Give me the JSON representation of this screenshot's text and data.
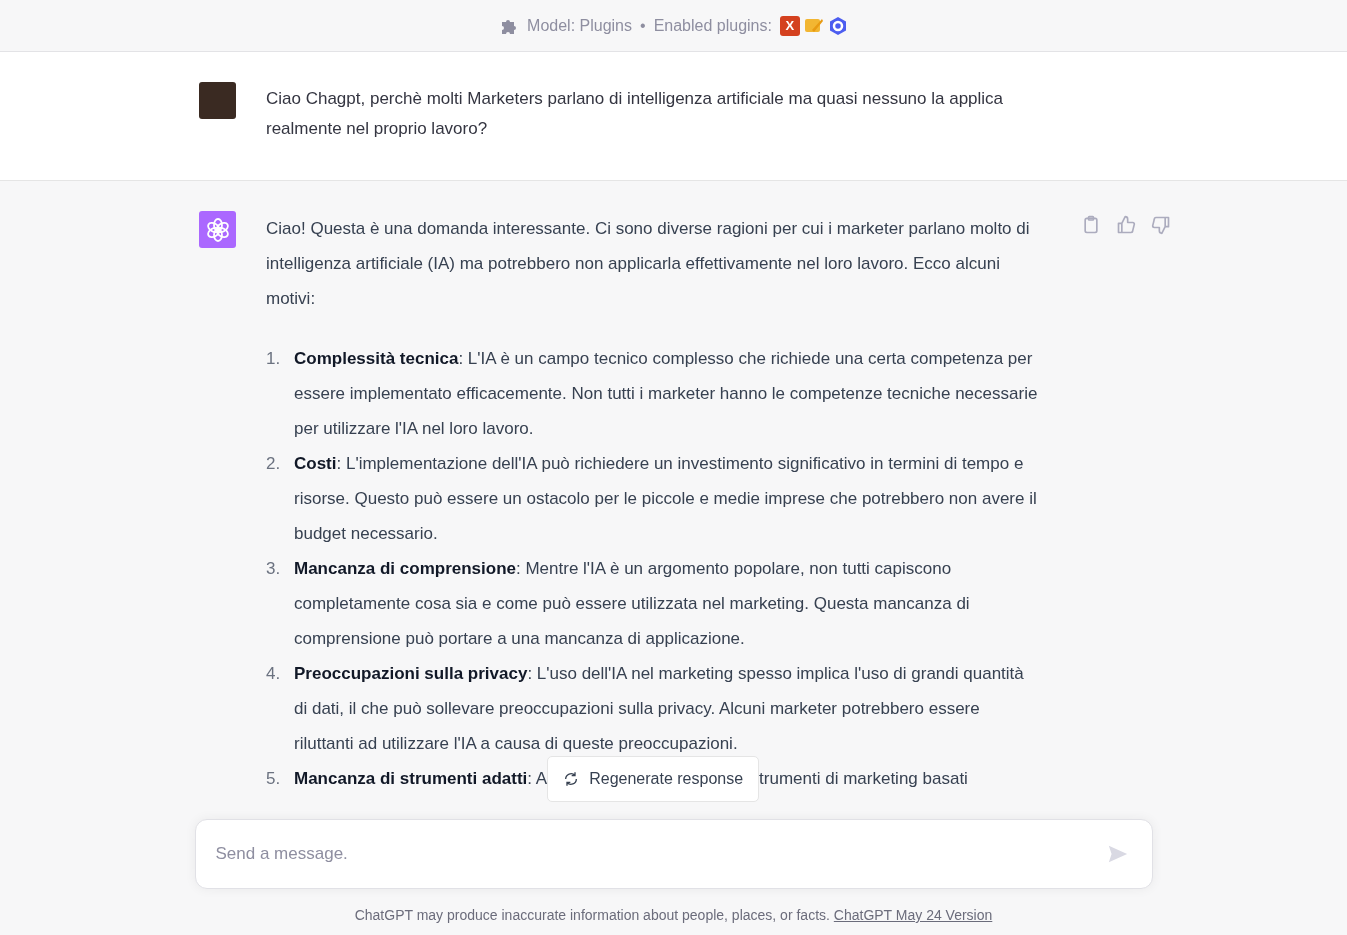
{
  "header": {
    "model_label": "Model: Plugins",
    "separator": "•",
    "plugins_label": "Enabled plugins:",
    "plugins": [
      {
        "kind": "letter",
        "text": "X",
        "color": "#d4411f"
      },
      {
        "kind": "pen",
        "color": "#f2b632"
      },
      {
        "kind": "ring",
        "color": "#4c5df0"
      }
    ]
  },
  "user_message": {
    "text": "Ciao Chagpt, perchè molti Marketers parlano di intelligenza artificiale ma quasi nessuno la applica realmente nel proprio lavoro?"
  },
  "assistant_message": {
    "intro": "Ciao! Questa è una domanda interessante. Ci sono diverse ragioni per cui i marketer parlano molto di intelligenza artificiale (IA) ma potrebbero non applicarla effettivamente nel loro lavoro. Ecco alcuni motivi:",
    "items": [
      {
        "number": "1.",
        "text": "**Complessità tecnica**: L'IA è un campo tecnico complesso che richiede una certa competenza per essere implementato efficacemente. Non tutti i marketer hanno le competenze tecniche necessarie per utilizzare l'IA nel loro lavoro."
      },
      {
        "number": "2.",
        "text": "**Costi**: L'implementazione dell'IA può richiedere un investimento significativo in termini di tempo e risorse. Questo può essere un ostacolo per le piccole e medie imprese che potrebbero non avere il budget necessario."
      },
      {
        "number": "3.",
        "text": "**Mancanza di comprensione**: Mentre l'IA è un argomento popolare, non tutti capiscono completamente cosa sia e come può essere utilizzata nel marketing. Questa mancanza di comprensione può portare a una mancanza di applicazione."
      },
      {
        "number": "4.",
        "text": "**Preoccupazioni sulla privacy**: L'uso dell'IA nel marketing spesso implica l'uso di grandi quantità di dati, il che può sollevare preoccupazioni sulla privacy. Alcuni marketer potrebbero essere riluttanti ad utilizzare l'IA a causa di queste preoccupazioni."
      },
      {
        "number": "5.",
        "text": "**Mancanza di strumenti adatti**: A",
        "text_after": "trumenti di marketing basati"
      }
    ]
  },
  "regenerate_button": {
    "label": "Regenerate response"
  },
  "composer": {
    "placeholder": "Send a message."
  },
  "footer": {
    "text": "ChatGPT may produce inaccurate information about people, places, or facts.",
    "link": "ChatGPT May 24 Version"
  }
}
